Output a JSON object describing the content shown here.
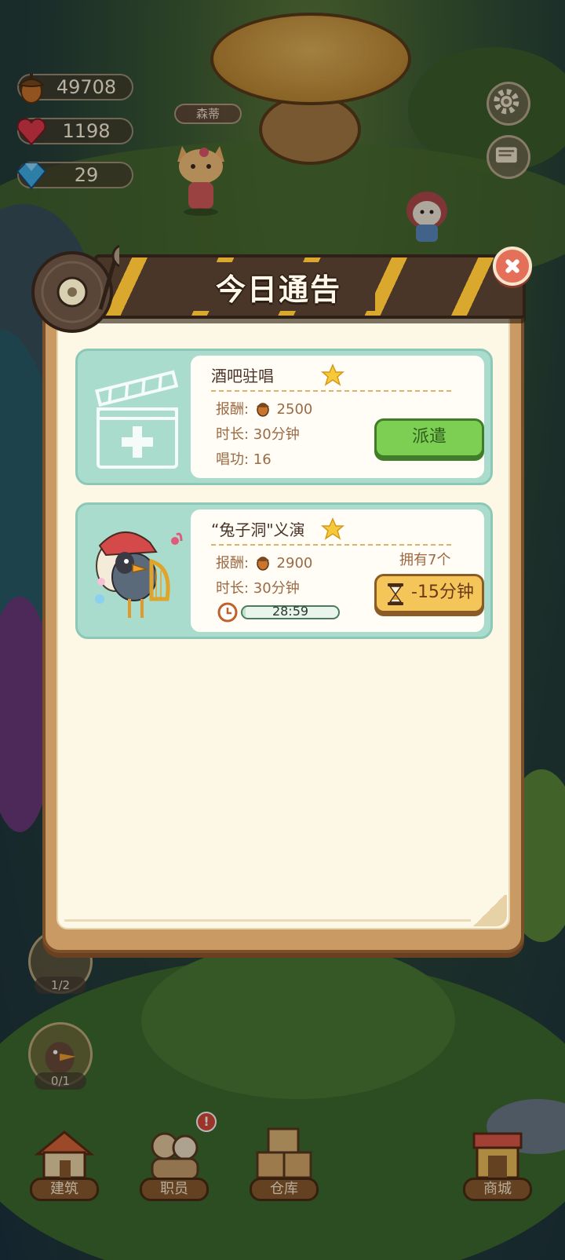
{
  "resources": {
    "acorns": "49708",
    "hearts": "1198",
    "gems": "29"
  },
  "scene": {
    "npc_name": "森蒂"
  },
  "dialog": {
    "title": "今日通告",
    "cards": [
      {
        "title": "酒吧驻唱",
        "reward_label": "报酬:",
        "reward_value": "2500",
        "duration": "时长: 30分钟",
        "skill": "唱功: 16",
        "button": "派遣"
      },
      {
        "title": "“兔子洞\"义演",
        "reward_label": "报酬:",
        "reward_value": "2900",
        "duration": "时长: 30分钟",
        "owned": "拥有7个",
        "timer": "28:59",
        "timer_progress": 0.03,
        "button": "-15分钟"
      }
    ]
  },
  "side_slots": [
    {
      "count": "1/2"
    },
    {
      "count": "0/1"
    }
  ],
  "nav": {
    "build": "建筑",
    "staff": "职员",
    "warehouse": "仓库",
    "shop": "商城",
    "staff_badge": "!"
  },
  "icons": {
    "acorn": "acorn-icon",
    "heart": "heart-icon",
    "gem": "gem-icon",
    "settings": "gear-icon",
    "book": "book-icon",
    "close": "close-icon",
    "star": "star-icon",
    "hourglass": "hourglass-icon",
    "clock": "clock-icon"
  },
  "colors": {
    "panel_border": "#7a4f2a",
    "card_bg": "#a9dccd",
    "green_button": "#7ccf52",
    "yellow_button": "#f4c65a",
    "close_button": "#e4705a"
  }
}
